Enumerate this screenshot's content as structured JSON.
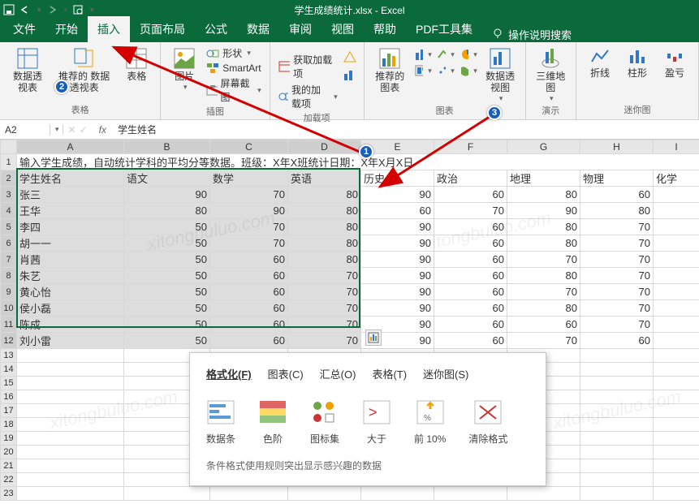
{
  "app_title": "学生成绩统计.xlsx  -  Excel",
  "tabs": [
    "文件",
    "开始",
    "插入",
    "页面布局",
    "公式",
    "数据",
    "审阅",
    "视图",
    "帮助",
    "PDF工具集"
  ],
  "active_tab": 2,
  "search_hint": "操作说明搜索",
  "ribbon": {
    "g1": {
      "label": "表格",
      "items": [
        "数据透\n视表",
        "推荐的\n数据透视表",
        "表格"
      ]
    },
    "g2": {
      "label": "插图",
      "items": [
        "图片"
      ],
      "small": [
        "形状",
        "SmartArt",
        "屏幕截图"
      ]
    },
    "g3": {
      "label": "加载项",
      "small": [
        "获取加载项",
        "我的加载项"
      ]
    },
    "g4": {
      "label": "图表",
      "items": [
        "推荐的\n图表",
        "数据透视图"
      ]
    },
    "g5": {
      "label": "演示",
      "items": [
        "三维地\n图"
      ]
    },
    "g6": {
      "label": "迷你图",
      "items": [
        "折线",
        "柱形",
        "盈亏"
      ]
    }
  },
  "namebox": "A2",
  "formula": "学生姓名",
  "columns": [
    "",
    "A",
    "B",
    "C",
    "D",
    "E",
    "F",
    "G",
    "H",
    "I"
  ],
  "row1_text": "输入学生成绩，自动统计学科的平均分等数据。班级：X年X班统计日期：X年X月X日",
  "headers": [
    "学生姓名",
    "语文",
    "数学",
    "英语",
    "历史",
    "政治",
    "地理",
    "物理",
    "化学"
  ],
  "students": [
    {
      "name": "张三",
      "s": [
        90,
        70,
        80,
        90,
        60,
        80,
        60,
        null
      ]
    },
    {
      "name": "王华",
      "s": [
        80,
        90,
        80,
        60,
        70,
        90,
        80,
        null
      ]
    },
    {
      "name": "李四",
      "s": [
        50,
        70,
        80,
        90,
        60,
        80,
        70,
        null
      ]
    },
    {
      "name": "胡一一",
      "s": [
        50,
        70,
        80,
        90,
        60,
        80,
        70,
        null
      ]
    },
    {
      "name": "肖茜",
      "s": [
        50,
        60,
        80,
        90,
        60,
        70,
        70,
        null
      ]
    },
    {
      "name": "朱艺",
      "s": [
        50,
        60,
        70,
        90,
        60,
        80,
        70,
        null
      ]
    },
    {
      "name": "黄心怡",
      "s": [
        50,
        60,
        70,
        90,
        60,
        70,
        70,
        null
      ]
    },
    {
      "name": "侯小磊",
      "s": [
        50,
        60,
        70,
        90,
        60,
        80,
        70,
        null
      ]
    },
    {
      "name": "陈成",
      "s": [
        50,
        60,
        70,
        90,
        60,
        60,
        70,
        null
      ]
    },
    {
      "name": "刘小雷",
      "s": [
        50,
        60,
        70,
        90,
        60,
        70,
        60,
        null
      ]
    }
  ],
  "popup": {
    "tabs": [
      "格式化(F)",
      "图表(C)",
      "汇总(O)",
      "表格(T)",
      "迷你图(S)"
    ],
    "active": 0,
    "items": [
      "数据条",
      "色阶",
      "图标集",
      "大于",
      "前 10%",
      "清除格式"
    ],
    "foot": "条件格式使用规则突出显示感兴趣的数据"
  },
  "markers": {
    "m1": "1",
    "m2": "2",
    "m3": "3"
  },
  "chart_data": {
    "type": "table",
    "title": "学生成绩统计",
    "columns": [
      "学生姓名",
      "语文",
      "数学",
      "英语",
      "历史",
      "政治",
      "地理",
      "物理"
    ],
    "rows": [
      [
        "张三",
        90,
        70,
        80,
        90,
        60,
        80,
        60
      ],
      [
        "王华",
        80,
        90,
        80,
        60,
        70,
        90,
        80
      ],
      [
        "李四",
        50,
        70,
        80,
        90,
        60,
        80,
        70
      ],
      [
        "胡一一",
        50,
        70,
        80,
        90,
        60,
        80,
        70
      ],
      [
        "肖茜",
        50,
        60,
        80,
        90,
        60,
        70,
        70
      ],
      [
        "朱艺",
        50,
        60,
        70,
        90,
        60,
        80,
        70
      ],
      [
        "黄心怡",
        50,
        60,
        70,
        90,
        60,
        70,
        70
      ],
      [
        "侯小磊",
        50,
        60,
        70,
        90,
        60,
        80,
        70
      ],
      [
        "陈成",
        50,
        60,
        70,
        90,
        60,
        60,
        70
      ],
      [
        "刘小雷",
        50,
        60,
        70,
        90,
        60,
        70,
        60
      ]
    ]
  }
}
